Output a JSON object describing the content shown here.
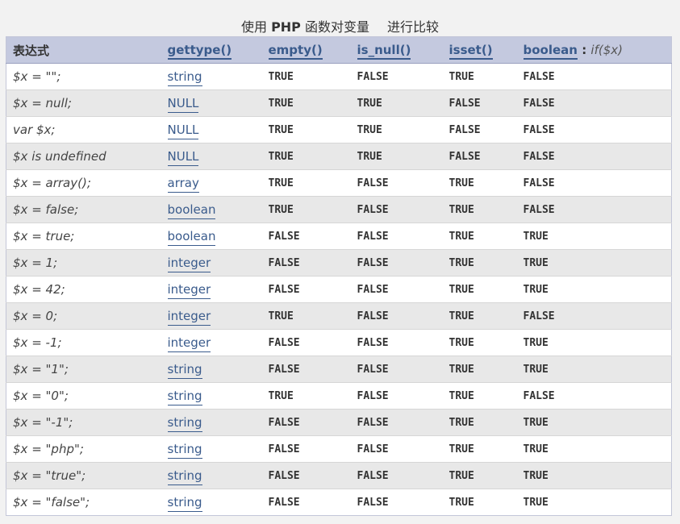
{
  "caption": {
    "prefix": "使用",
    "php": "PHP",
    "mid": "函数对变量",
    "suffix": "进行比较"
  },
  "headers": {
    "expr": "表达式",
    "gettype": "gettype()",
    "empty": "empty()",
    "is_null": "is_null()",
    "isset": "isset()",
    "boolean": "boolean",
    "boolean_sep": " : ",
    "boolean_hint": "if($x)"
  },
  "rows": [
    {
      "expr": "$x = \"\";",
      "type": "string",
      "empty": "TRUE",
      "is_null": "FALSE",
      "isset": "TRUE",
      "bool": "FALSE"
    },
    {
      "expr": "$x = null;",
      "type": "NULL",
      "empty": "TRUE",
      "is_null": "TRUE",
      "isset": "FALSE",
      "bool": "FALSE"
    },
    {
      "expr": "var $x;",
      "type": "NULL",
      "empty": "TRUE",
      "is_null": "TRUE",
      "isset": "FALSE",
      "bool": "FALSE"
    },
    {
      "expr": "$x is undefined",
      "type": "NULL",
      "empty": "TRUE",
      "is_null": "TRUE",
      "isset": "FALSE",
      "bool": "FALSE"
    },
    {
      "expr": "$x = array();",
      "type": "array",
      "empty": "TRUE",
      "is_null": "FALSE",
      "isset": "TRUE",
      "bool": "FALSE"
    },
    {
      "expr": "$x = false;",
      "type": "boolean",
      "empty": "TRUE",
      "is_null": "FALSE",
      "isset": "TRUE",
      "bool": "FALSE"
    },
    {
      "expr": "$x = true;",
      "type": "boolean",
      "empty": "FALSE",
      "is_null": "FALSE",
      "isset": "TRUE",
      "bool": "TRUE"
    },
    {
      "expr": "$x = 1;",
      "type": "integer",
      "empty": "FALSE",
      "is_null": "FALSE",
      "isset": "TRUE",
      "bool": "TRUE"
    },
    {
      "expr": "$x = 42;",
      "type": "integer",
      "empty": "FALSE",
      "is_null": "FALSE",
      "isset": "TRUE",
      "bool": "TRUE"
    },
    {
      "expr": "$x = 0;",
      "type": "integer",
      "empty": "TRUE",
      "is_null": "FALSE",
      "isset": "TRUE",
      "bool": "FALSE"
    },
    {
      "expr": "$x = -1;",
      "type": "integer",
      "empty": "FALSE",
      "is_null": "FALSE",
      "isset": "TRUE",
      "bool": "TRUE"
    },
    {
      "expr": "$x = \"1\";",
      "type": "string",
      "empty": "FALSE",
      "is_null": "FALSE",
      "isset": "TRUE",
      "bool": "TRUE"
    },
    {
      "expr": "$x = \"0\";",
      "type": "string",
      "empty": "TRUE",
      "is_null": "FALSE",
      "isset": "TRUE",
      "bool": "FALSE"
    },
    {
      "expr": "$x = \"-1\";",
      "type": "string",
      "empty": "FALSE",
      "is_null": "FALSE",
      "isset": "TRUE",
      "bool": "TRUE"
    },
    {
      "expr": "$x = \"php\";",
      "type": "string",
      "empty": "FALSE",
      "is_null": "FALSE",
      "isset": "TRUE",
      "bool": "TRUE"
    },
    {
      "expr": "$x = \"true\";",
      "type": "string",
      "empty": "FALSE",
      "is_null": "FALSE",
      "isset": "TRUE",
      "bool": "TRUE"
    },
    {
      "expr": "$x = \"false\";",
      "type": "string",
      "empty": "FALSE",
      "is_null": "FALSE",
      "isset": "TRUE",
      "bool": "TRUE"
    }
  ]
}
